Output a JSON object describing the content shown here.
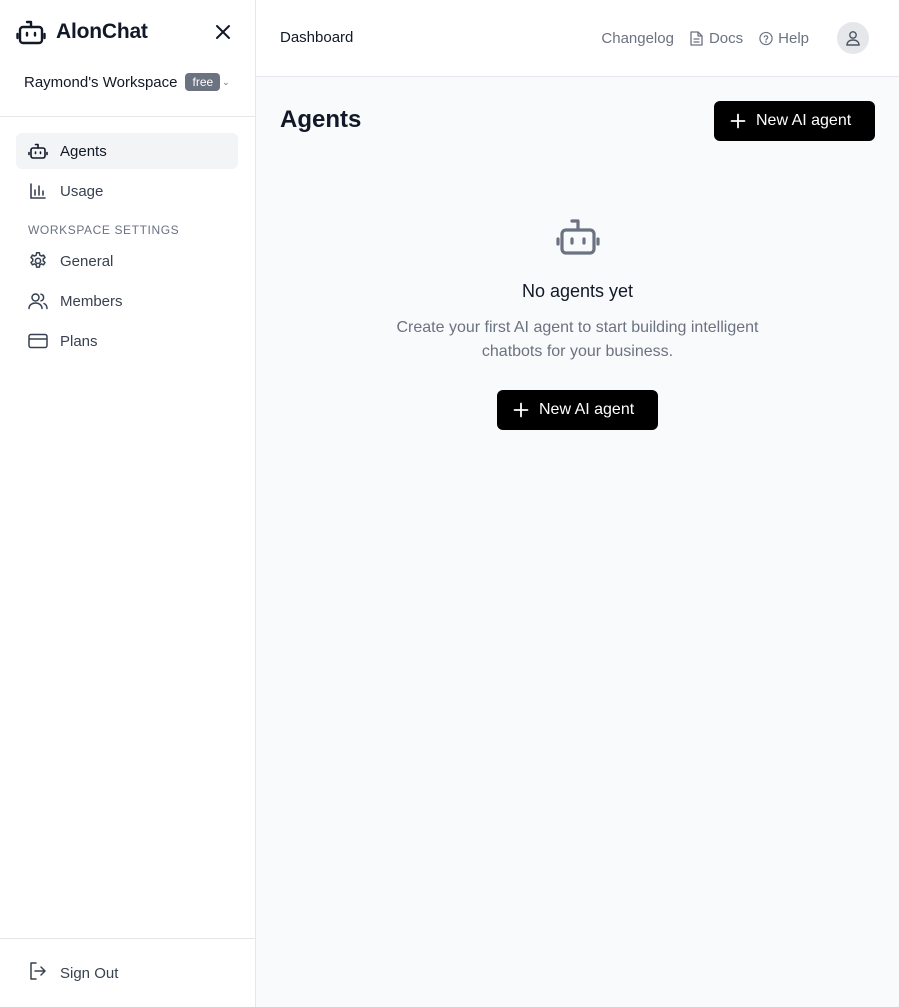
{
  "brand": {
    "name": "AlonChat",
    "logo_icon": "robot-icon"
  },
  "workspace": {
    "name": "Raymond's Workspace",
    "plan_badge": "free"
  },
  "sidebar": {
    "items": [
      {
        "label": "Agents",
        "icon": "robot-icon",
        "active": true
      },
      {
        "label": "Usage",
        "icon": "bar-chart-icon",
        "active": false
      }
    ],
    "section_title": "WORKSPACE SETTINGS",
    "settings_items": [
      {
        "label": "General",
        "icon": "gear-icon"
      },
      {
        "label": "Members",
        "icon": "users-icon"
      },
      {
        "label": "Plans",
        "icon": "credit-card-icon"
      }
    ],
    "sign_out": "Sign Out"
  },
  "header": {
    "breadcrumb": "Dashboard",
    "links": {
      "changelog": "Changelog",
      "docs": "Docs",
      "help": "Help"
    }
  },
  "main": {
    "title": "Agents",
    "new_agent_button": "New AI agent",
    "empty_state": {
      "title": "No agents yet",
      "description": "Create your first AI agent to start building intelligent chatbots for your business.",
      "button": "New AI agent"
    }
  },
  "colors": {
    "primary_button": "#000000",
    "sidebar_active": "#f3f4f6",
    "page_bg": "#f9fafb",
    "badge_bg": "#6b7280"
  }
}
